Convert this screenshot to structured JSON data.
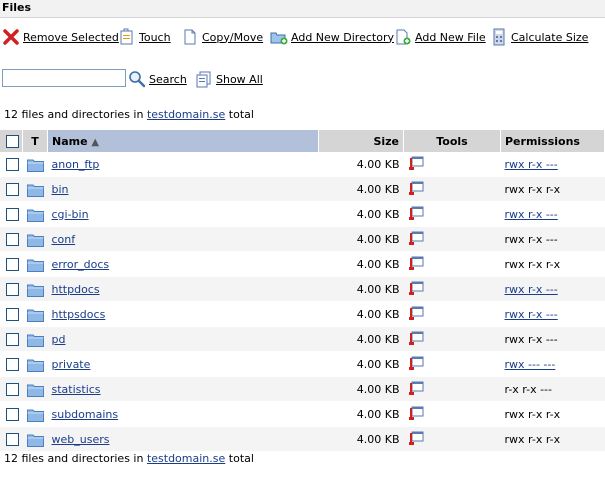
{
  "section": {
    "title": "Files"
  },
  "toolbar": {
    "remove_selected": "Remove Selected",
    "touch": "Touch",
    "copy_move": "Copy/Move",
    "add_directory": "Add New Directory",
    "add_file": "Add New File",
    "calculate_size": "Calculate Size"
  },
  "search": {
    "value": "",
    "search_label": "Search",
    "show_all_label": "Show All"
  },
  "summary": {
    "prefix": "12 files and directories in",
    "domain": "testdomain.se",
    "suffix": "total"
  },
  "table": {
    "headers": {
      "t": "T",
      "name": "Name",
      "size": "Size",
      "tools": "Tools",
      "permissions": "Permissions"
    },
    "rows": [
      {
        "name": "anon_ftp",
        "size": "4.00 KB",
        "perm": "rwx r-x ---",
        "perm_link": true
      },
      {
        "name": "bin",
        "size": "4.00 KB",
        "perm": "rwx r-x r-x",
        "perm_link": false
      },
      {
        "name": "cgi-bin",
        "size": "4.00 KB",
        "perm": "rwx r-x ---",
        "perm_link": true
      },
      {
        "name": "conf",
        "size": "4.00 KB",
        "perm": "rwx r-x ---",
        "perm_link": false
      },
      {
        "name": "error_docs",
        "size": "4.00 KB",
        "perm": "rwx r-x r-x",
        "perm_link": false
      },
      {
        "name": "httpdocs",
        "size": "4.00 KB",
        "perm": "rwx r-x ---",
        "perm_link": true
      },
      {
        "name": "httpsdocs",
        "size": "4.00 KB",
        "perm": "rwx r-x ---",
        "perm_link": true
      },
      {
        "name": "pd",
        "size": "4.00 KB",
        "perm": "rwx r-x ---",
        "perm_link": false
      },
      {
        "name": "private",
        "size": "4.00 KB",
        "perm": "rwx --- ---",
        "perm_link": true
      },
      {
        "name": "statistics",
        "size": "4.00 KB",
        "perm": "r-x r-x ---",
        "perm_link": false
      },
      {
        "name": "subdomains",
        "size": "4.00 KB",
        "perm": "rwx r-x r-x",
        "perm_link": false
      },
      {
        "name": "web_users",
        "size": "4.00 KB",
        "perm": "rwx r-x r-x",
        "perm_link": false
      }
    ]
  },
  "icons": {
    "remove": "remove-icon",
    "touch": "touch-icon",
    "copy": "copy-move-icon",
    "add_dir": "add-directory-icon",
    "add_file": "add-file-icon",
    "calc": "calculate-size-icon",
    "search": "search-icon",
    "show_all": "show-all-icon",
    "folder": "folder-icon",
    "tools": "edit-properties-icon"
  },
  "colors": {
    "header_bg": "#d5d5d5",
    "sorted_header_bg": "#b3c0d9",
    "link": "#1a3d8a"
  }
}
